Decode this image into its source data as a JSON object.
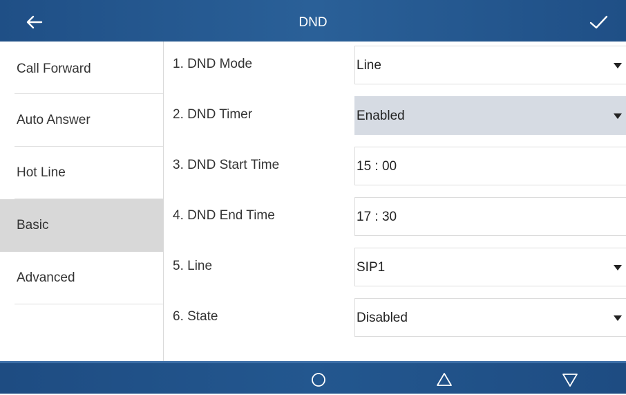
{
  "header": {
    "title": "DND",
    "back_icon": "arrow-left-icon",
    "confirm_icon": "checkmark-icon"
  },
  "sidebar": {
    "items": [
      {
        "label": "Call Forward",
        "active": false
      },
      {
        "label": "Auto Answer",
        "active": false
      },
      {
        "label": "Hot Line",
        "active": false
      },
      {
        "label": "Basic",
        "active": true
      },
      {
        "label": "Advanced",
        "active": false
      }
    ]
  },
  "settings": [
    {
      "label": "1. DND Mode",
      "value": "Line",
      "dropdown": true,
      "highlighted": false
    },
    {
      "label": "2. DND Timer",
      "value": "Enabled",
      "dropdown": true,
      "highlighted": true
    },
    {
      "label": "3. DND Start Time",
      "value": "15 : 00",
      "dropdown": false,
      "highlighted": false
    },
    {
      "label": "4. DND End Time",
      "value": "17 : 30",
      "dropdown": false,
      "highlighted": false
    },
    {
      "label": "5. Line",
      "value": "SIP1",
      "dropdown": true,
      "highlighted": false
    },
    {
      "label": "6. State",
      "value": "Disabled",
      "dropdown": true,
      "highlighted": false
    }
  ],
  "navbar": {
    "icons": [
      "circle-home-icon",
      "triangle-up-icon",
      "triangle-down-icon"
    ]
  },
  "colors": {
    "header_bg": "#2a6098",
    "navbar_bg": "#23578f",
    "active_sidebar_bg": "#d8d8d8",
    "highlight_field_bg": "#d6dbe3"
  }
}
